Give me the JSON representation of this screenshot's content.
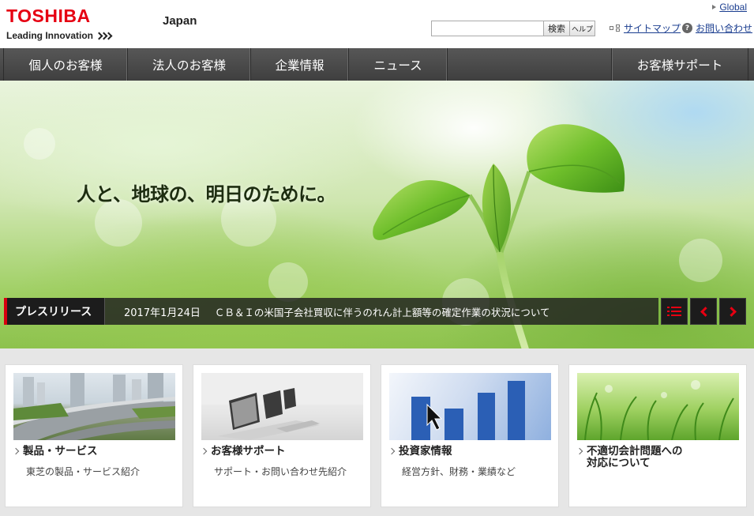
{
  "header": {
    "logo_text": "TOSHIBA",
    "tagline": "Leading Innovation",
    "region": "Japan",
    "global_link": "Global",
    "search_placeholder": "",
    "search_button": "検索",
    "help_button": "ヘルプ",
    "sitemap_link": "サイトマップ",
    "contact_link": "お問い合わせ"
  },
  "nav": {
    "items": [
      {
        "label": "個人のお客様"
      },
      {
        "label": "法人のお客様"
      },
      {
        "label": "企業情報"
      },
      {
        "label": "ニュース"
      }
    ],
    "support": "お客様サポート"
  },
  "hero": {
    "tagline": "人と、地球の、明日のために。"
  },
  "press": {
    "label": "プレスリリース",
    "date": "2017年1月24日",
    "title": "ＣＢ＆Ｉの米国子会社買収に伴うのれん計上額等の確定作業の状況について"
  },
  "cards": [
    {
      "title": "製品・サービス",
      "subtitle": "東芝の製品・サービス紹介"
    },
    {
      "title": "お客様サポート",
      "subtitle": "サポート・お問い合わせ先紹介"
    },
    {
      "title": "投資家情報",
      "subtitle": "経営方針、財務・業績など"
    },
    {
      "title_line1": "不適切会計問題への",
      "title_line2": "対応について"
    }
  ],
  "colors": {
    "brand_red": "#e60012",
    "nav_bg": "#4a4a4a",
    "link": "#1a3d8f"
  }
}
